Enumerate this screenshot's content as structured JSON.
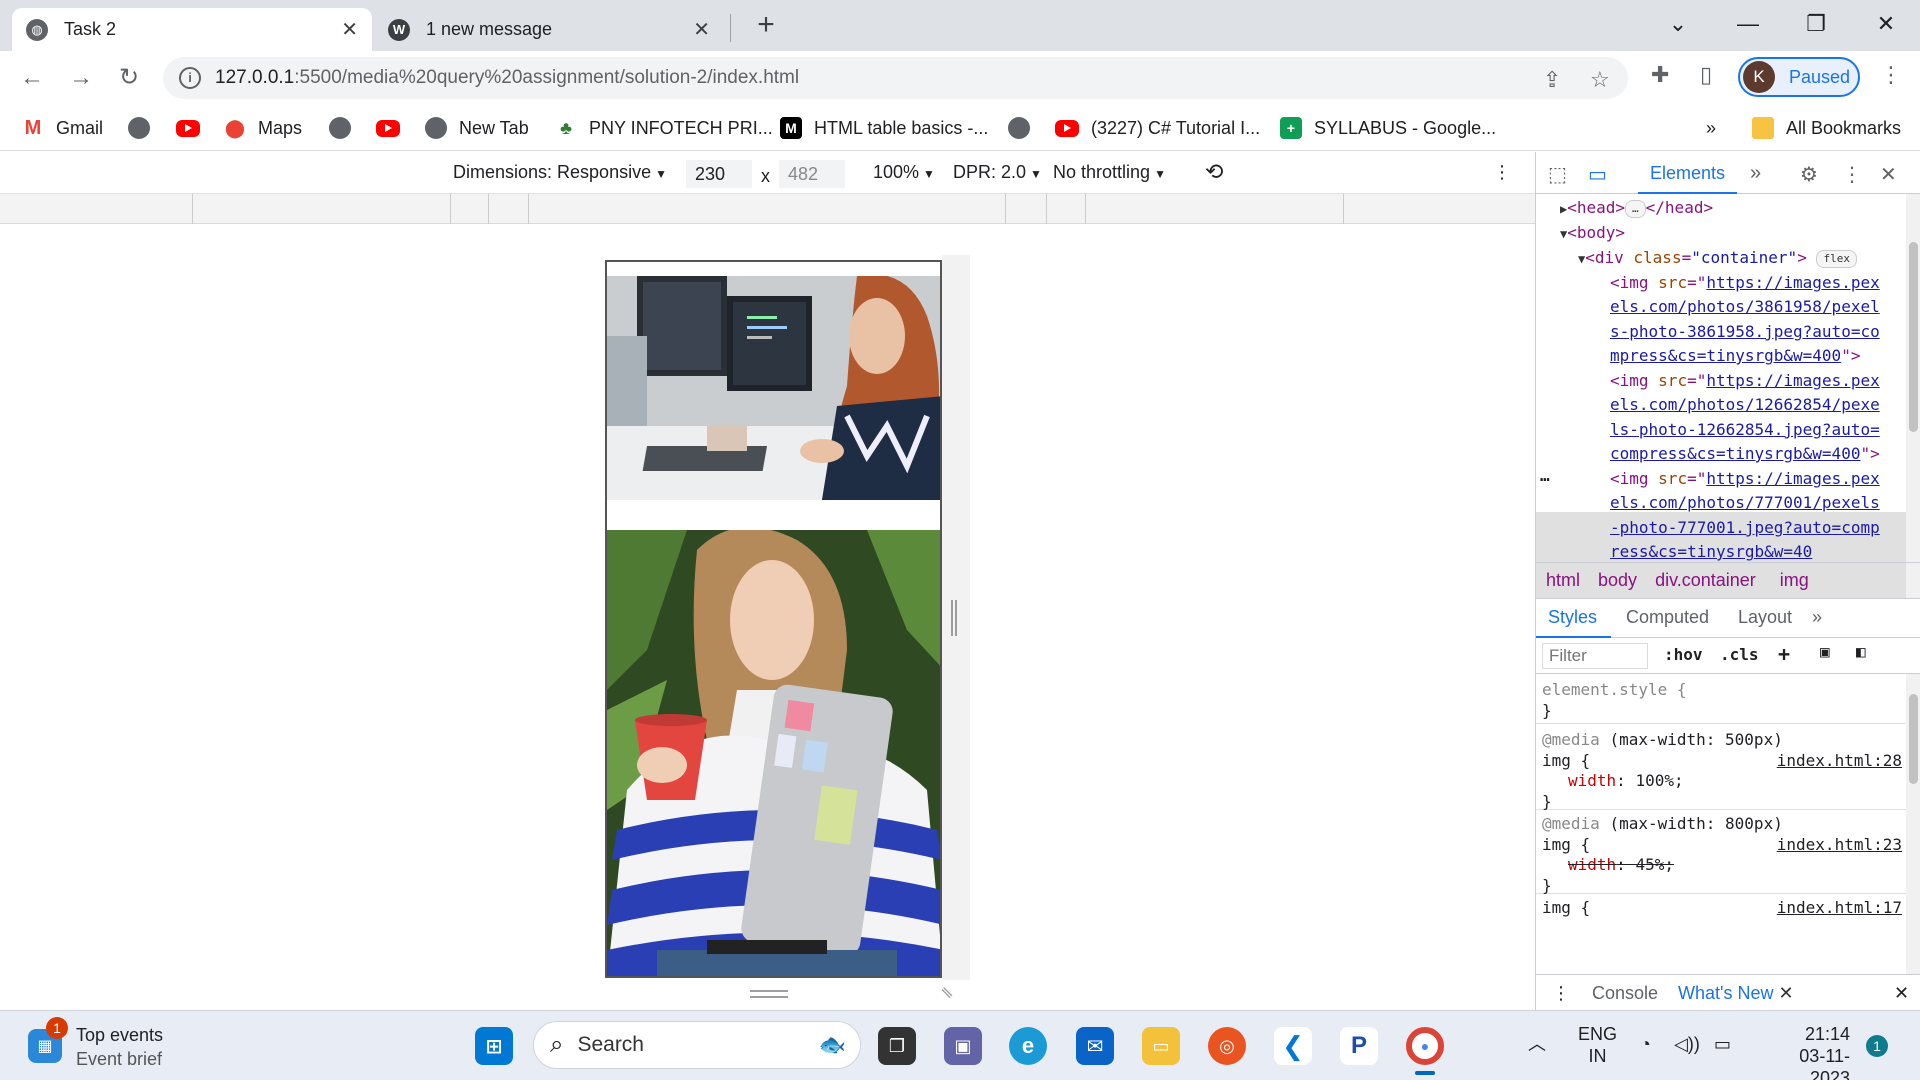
{
  "browser": {
    "tabs": [
      {
        "title": "Task 2",
        "active": true,
        "icon": "globe-icon"
      },
      {
        "title": "1 new message",
        "active": false,
        "icon": "wordpress-icon"
      }
    ],
    "url_host": "127.0.0.1",
    "url_rest": ":5500/media%20query%20assignment/solution-2/index.html",
    "profile_initial": "K",
    "profile_status": "Paused"
  },
  "bookmarks": [
    {
      "label": "Gmail",
      "icon": "gmail-icon"
    },
    {
      "label": "",
      "icon": "globe-icon"
    },
    {
      "label": "",
      "icon": "youtube-icon"
    },
    {
      "label": "Maps",
      "icon": "maps-icon"
    },
    {
      "label": "",
      "icon": "globe-icon"
    },
    {
      "label": "",
      "icon": "youtube-icon"
    },
    {
      "label": "New Tab",
      "icon": "globe-icon"
    },
    {
      "label": "PNY INFOTECH PRI...",
      "icon": "pny-icon"
    },
    {
      "label": "HTML table basics -...",
      "icon": "m-icon"
    },
    {
      "label": "",
      "icon": "globe-icon"
    },
    {
      "label": "(3227) C# Tutorial I...",
      "icon": "youtube-icon"
    },
    {
      "label": "SYLLABUS - Google...",
      "icon": "sheets-icon"
    }
  ],
  "bookmarks_more": "»",
  "all_bookmarks": "All Bookmarks",
  "device_toolbar": {
    "dimensions_label": "Dimensions: Responsive",
    "width": "230",
    "times": "x",
    "height": "482",
    "zoom": "100%",
    "dpr": "DPR: 2.0",
    "throttling": "No throttling"
  },
  "devtools": {
    "active_tab": "Elements",
    "dom": {
      "head_open": "<head>",
      "head_close": "</head>",
      "body": "<body>",
      "div_open": "<div ",
      "div_attr": "class",
      "div_val": "\"container\"",
      "flex_badge": "flex",
      "img_tag": "<img ",
      "src_attr": "src",
      "img1_lines": [
        "https://images.pex",
        "els.com/photos/3861958/pexel",
        "s-photo-3861958.jpeg?auto=co",
        "mpress&cs=tinysrgb&w=400"
      ],
      "img2_lines": [
        "https://images.pex",
        "els.com/photos/12662854/pexe",
        "ls-photo-12662854.jpeg?auto=",
        "compress&cs=tinysrgb&w=400"
      ],
      "img3_lines": [
        "https://images.pex",
        "els.com/photos/777001/pexels",
        "-photo-777001.jpeg?auto=comp",
        "ress&cs=tinysrgb&w=40"
      ]
    },
    "breadcrumbs": [
      "html",
      "body",
      "div.container",
      "img"
    ],
    "styles_tabs": [
      "Styles",
      "Computed",
      "Layout"
    ],
    "filter_placeholder": "Filter",
    "hov": ":hov",
    "cls": ".cls",
    "rules": {
      "element_style": "element.style {",
      "close": "}",
      "media1": "(max-width: 500px)",
      "media2": "(max-width: 800px)",
      "media_kw": "@media",
      "selector": "img {",
      "src1": "index.html:28",
      "src2": "index.html:23",
      "src3": "index.html:17",
      "prop_width": "width",
      "val1": "100%;",
      "val2": "45%;"
    },
    "drawer": {
      "console": "Console",
      "whats_new": "What's New"
    }
  },
  "taskbar": {
    "widget_title": "Top events",
    "widget_sub": "Event brief",
    "widget_badge": "1",
    "search": "Search",
    "lang": "ENG",
    "region": "IN",
    "time": "21:14",
    "date": "03-11-2023",
    "notif_count": "1"
  }
}
